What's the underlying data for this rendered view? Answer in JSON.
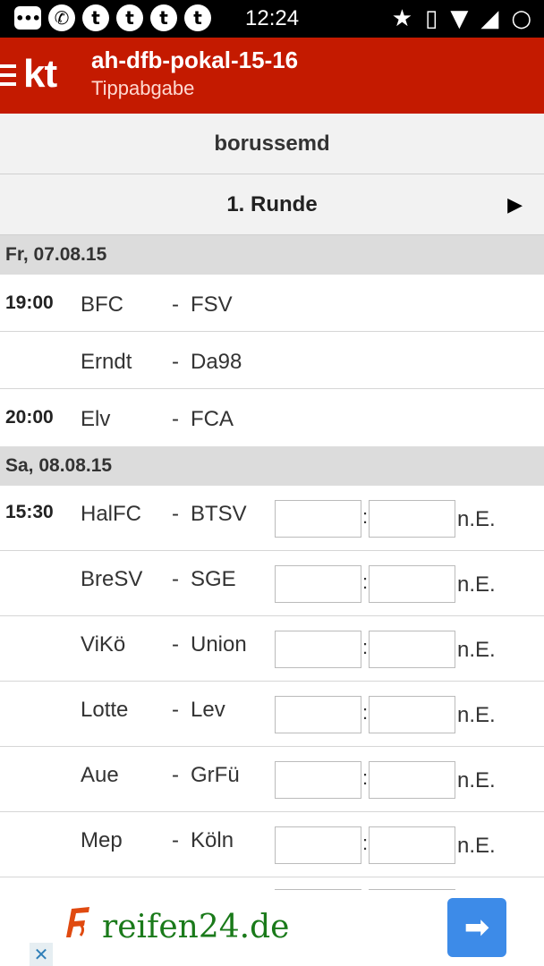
{
  "status_bar": {
    "time": "12:24",
    "icons": [
      "chat-icon",
      "whatsapp-icon",
      "tumblr-icon",
      "tumblr-icon",
      "tumblr-icon",
      "tumblr-icon",
      "star-icon",
      "vibrate-icon",
      "wifi-icon",
      "signal-icon",
      "circle-icon"
    ]
  },
  "app": {
    "logo": "kt",
    "title": "ah-dfb-pokal-15-16",
    "subtitle": "Tippabgabe"
  },
  "user": "borussemd",
  "round": {
    "label": "1. Runde",
    "next_icon": "▶"
  },
  "days": [
    {
      "date": "Fr, 07.08.15",
      "matches": [
        {
          "time": "19:00",
          "home": "BFC",
          "away": "FSV"
        },
        {
          "time": "",
          "home": "Erndt",
          "away": "Da98"
        },
        {
          "time": "20:00",
          "home": "Elv",
          "away": "FCA"
        }
      ]
    },
    {
      "date": "Sa, 08.08.15",
      "matches": [
        {
          "time": "15:30",
          "home": "HalFC",
          "away": "BTSV"
        },
        {
          "time": "",
          "home": "BreSV",
          "away": "SGE"
        },
        {
          "time": "",
          "home": "ViKö",
          "away": "Union"
        },
        {
          "time": "",
          "home": "Lotte",
          "away": "Lev"
        },
        {
          "time": "",
          "home": "Aue",
          "away": "GrFü"
        },
        {
          "time": "",
          "home": "Mep",
          "away": "Köln"
        }
      ]
    }
  ],
  "labels": {
    "dash": "-",
    "colon": ":",
    "ne": "n.E."
  },
  "ad": {
    "text": "reifen24.de",
    "go_icon": "➡",
    "close_icon": "✕"
  }
}
